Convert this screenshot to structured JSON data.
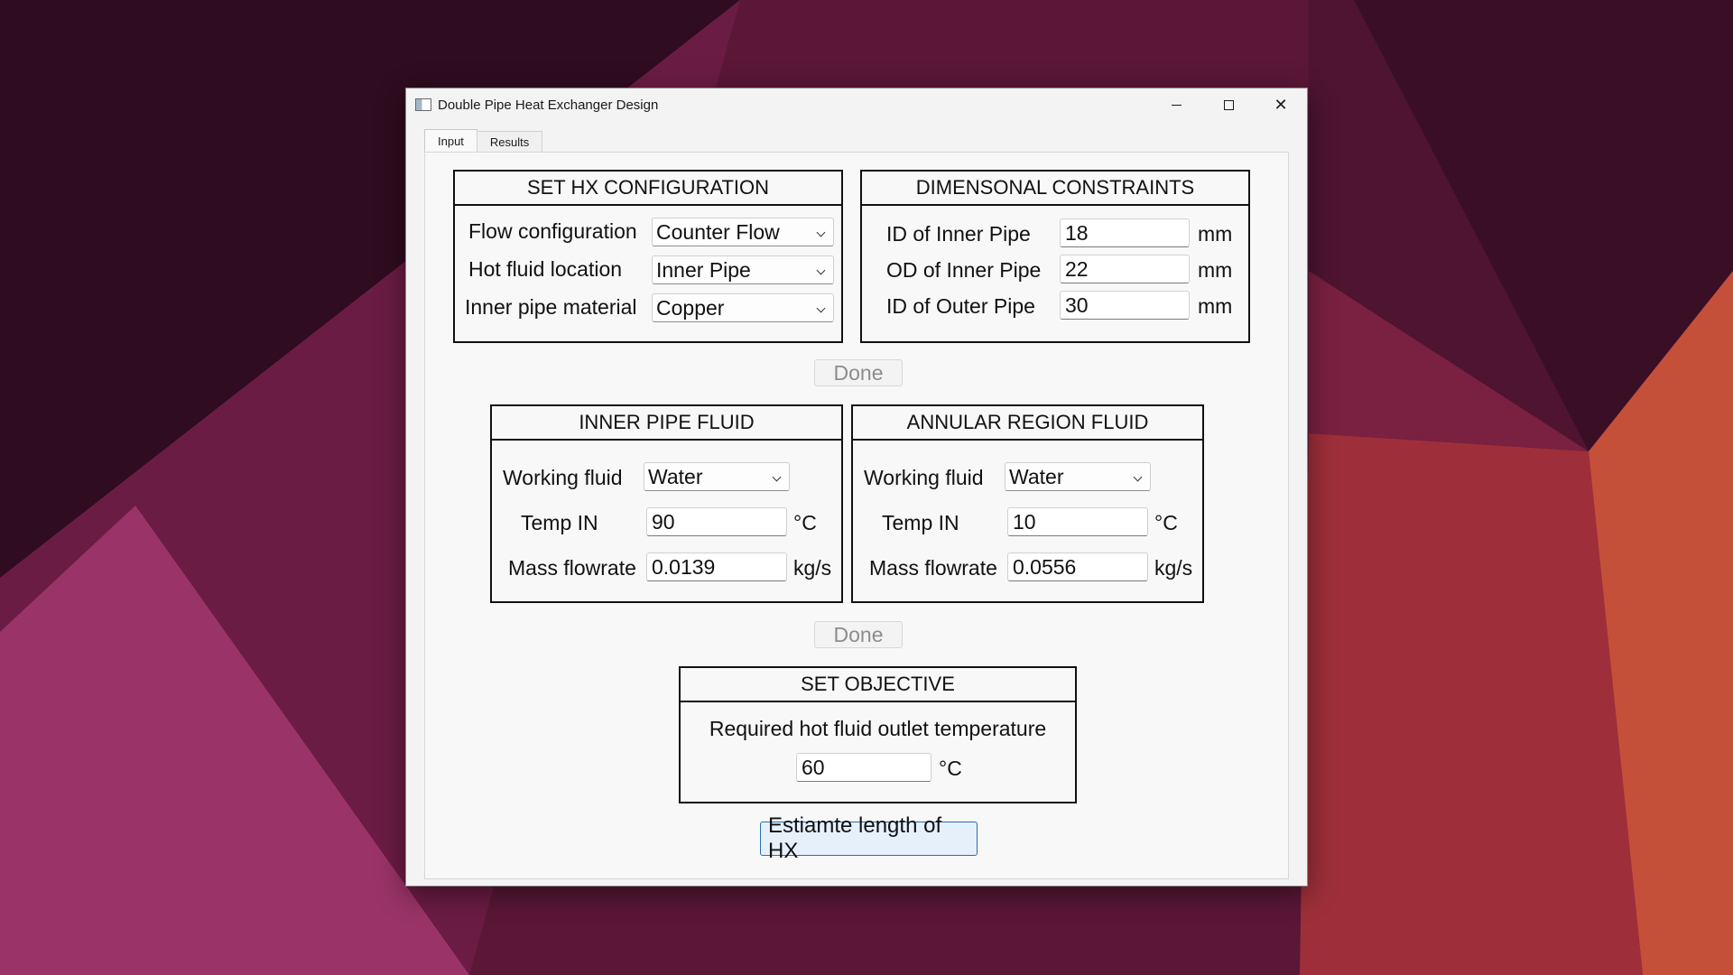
{
  "window": {
    "title": "Double Pipe Heat Exchanger Design",
    "controls": {
      "minimize": "minimize",
      "maximize": "maximize",
      "close": "✕"
    }
  },
  "tabs": [
    {
      "label": "Input",
      "active": true
    },
    {
      "label": "Results",
      "active": false
    }
  ],
  "hx_config": {
    "title": "SET HX CONFIGURATION",
    "flow_label": "Flow configuration",
    "flow_value": "Counter Flow",
    "hot_label": "Hot fluid location",
    "hot_value": "Inner Pipe",
    "material_label": "Inner pipe material",
    "material_value": "Copper"
  },
  "dimensions": {
    "title": "DIMENSONAL CONSTRAINTS",
    "id_inner_label": "ID of Inner Pipe",
    "id_inner_value": "18",
    "od_inner_label": "OD of Inner Pipe",
    "od_inner_value": "22",
    "id_outer_label": "ID of Outer Pipe",
    "id_outer_value": "30",
    "unit": "mm"
  },
  "done_1": "Done",
  "inner_fluid": {
    "title": "INNER PIPE FLUID",
    "fluid_label": "Working fluid",
    "fluid_value": "Water",
    "temp_label": "Temp IN",
    "temp_value": "90",
    "temp_unit": "°C",
    "flow_label": "Mass flowrate",
    "flow_value": "0.0139",
    "flow_unit": "kg/s"
  },
  "annular_fluid": {
    "title": "ANNULAR REGION FLUID",
    "fluid_label": "Working fluid",
    "fluid_value": "Water",
    "temp_label": "Temp IN",
    "temp_value": "10",
    "temp_unit": "°C",
    "flow_label": "Mass flowrate",
    "flow_value": "0.0556",
    "flow_unit": "kg/s"
  },
  "done_2": "Done",
  "objective": {
    "title": "SET OBJECTIVE",
    "description": "Required hot fluid outlet temperature",
    "value": "60",
    "unit": "°C"
  },
  "estimate_button": "Estiamte length of HX",
  "colors": {
    "accent": "#2a6db3",
    "window_bg": "#f3f3f3"
  }
}
